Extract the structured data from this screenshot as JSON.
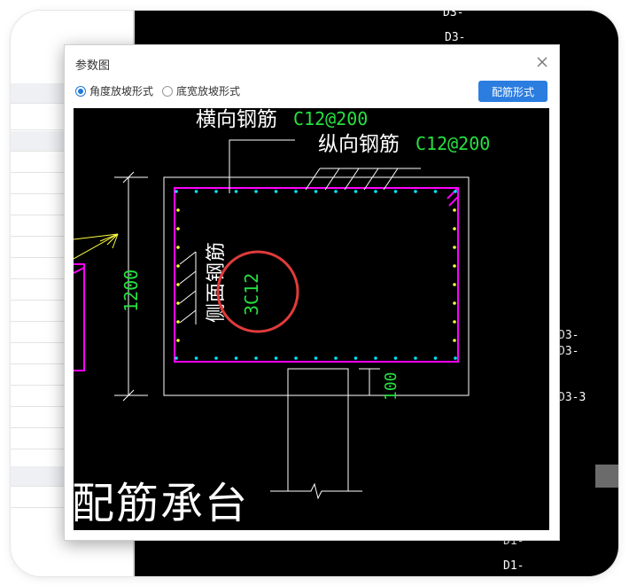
{
  "dialog": {
    "title": "参数图",
    "close_icon": "close-icon",
    "radios": [
      {
        "label": "角度放坡形式",
        "checked": true
      },
      {
        "label": "底宽放坡形式",
        "checked": false
      }
    ],
    "rebar_button_label": "配筋形式"
  },
  "drawing": {
    "transverse_label": "横向钢筋",
    "transverse_spec": "C12@200",
    "longitudinal_label": "纵向钢筋",
    "longitudinal_spec": "C12@200",
    "side_label": "侧面钢筋",
    "side_spec": "3C12",
    "height_dim": "1200",
    "cover_dim": "100",
    "caption": "配筋承台",
    "colors": {
      "outline": "#ffffff",
      "rebar": "#ff00ff",
      "dots": "#00e5ff",
      "text_green": "#27e040",
      "highlight": "#e03b3b",
      "yellow": "#ffff40"
    }
  },
  "background_canvas": {
    "labels": [
      "D3-",
      "D3-",
      "D3-",
      "D3-",
      "D3-3",
      "D1-",
      "D1-"
    ]
  }
}
